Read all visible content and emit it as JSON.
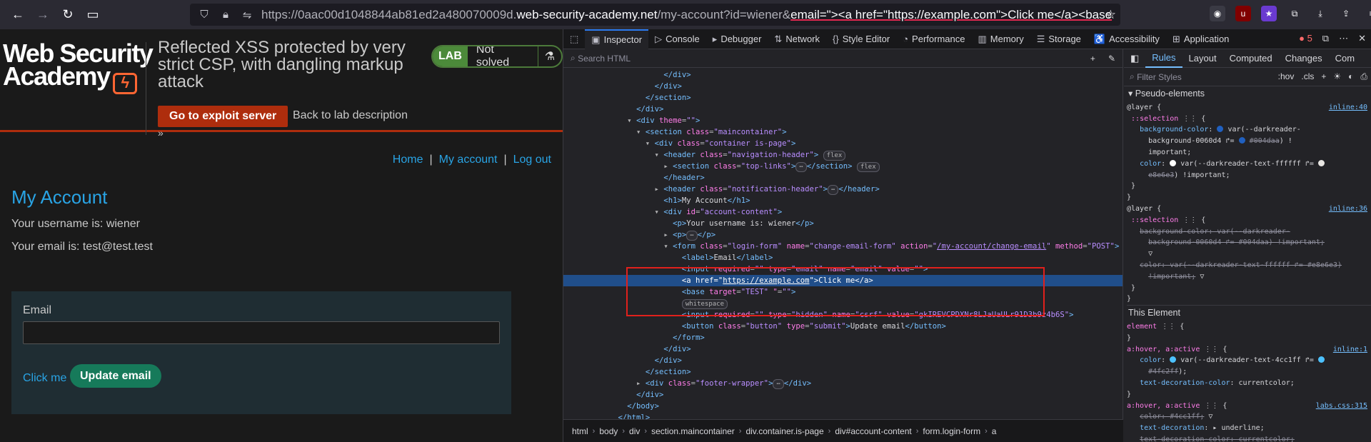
{
  "browser": {
    "url_prefix": "https://0aac00d1048844ab81ed2a480070009d.",
    "url_host": "web-security-academy.net",
    "url_path": "/my-account?id=wiener&",
    "url_highlight": "email=\"><a href=\"https://example.com\">Click me</a><base"
  },
  "lab": {
    "logo_line1": "Web Security",
    "logo_line2": "Academy",
    "title": "Reflected XSS protected by very strict CSP, with dangling markup attack",
    "status_tag": "LAB",
    "status_text": "Not solved",
    "exploit_button": "Go to exploit server",
    "back_link": "Back to lab description",
    "chevron": "»"
  },
  "nav": {
    "home": "Home",
    "sep": "|",
    "account": "My account",
    "logout": "Log out"
  },
  "account": {
    "heading": "My Account",
    "username_line": "Your username is: wiener",
    "email_line": "Your email is: test@test.test",
    "email_label": "Email",
    "click_me": "Click me",
    "update_button": "Update email"
  },
  "devtools": {
    "tabs": [
      "Inspector",
      "Console",
      "Debugger",
      "Network",
      "Style Editor",
      "Performance",
      "Memory",
      "Storage",
      "Accessibility",
      "Application"
    ],
    "error_count": "5",
    "search_placeholder": "Search HTML",
    "breadcrumbs": [
      "html",
      "body",
      "div",
      "section.maincontainer",
      "div.container.is-page",
      "div#account-content",
      "form.login-form",
      "a"
    ],
    "rules_tabs": [
      "Rules",
      "Layout",
      "Computed",
      "Changes",
      "Com"
    ],
    "filter_placeholder": "Filter Styles",
    "filter_hov": ":hov",
    "filter_cls": ".cls",
    "pseudo_section": "Pseudo-elements",
    "this_element": "This Element",
    "src_inline40": "inline:40",
    "src_inline36": "inline:36",
    "src_inline1": "inline:1",
    "src_labs": "labs.css:315"
  },
  "colors": {
    "accent": "#29a4e5",
    "exploit": "#ae2d0d",
    "update": "#167a5a",
    "highlight_box": "#e0201c"
  }
}
